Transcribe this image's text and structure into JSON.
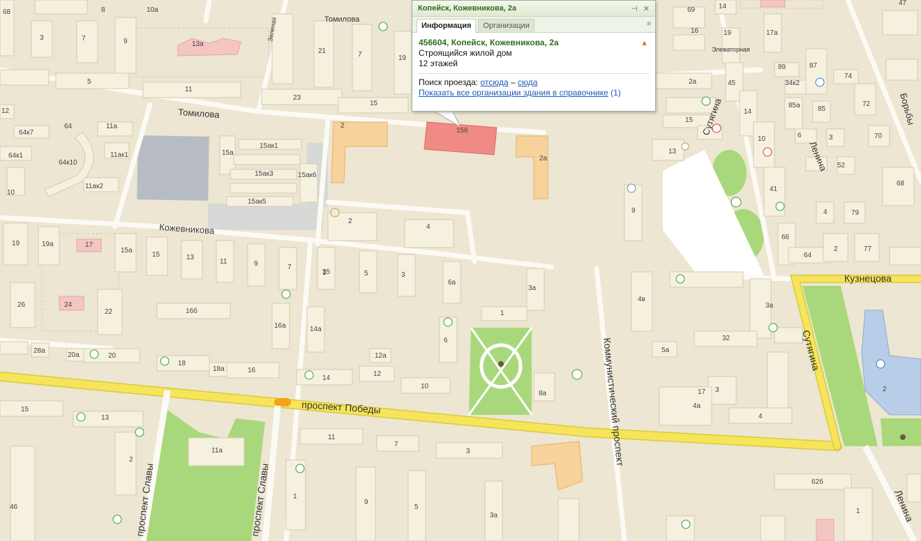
{
  "popup": {
    "header": "Копейск, Кожевникова, 2а",
    "pin_icon": "pin-icon",
    "close_icon": "close-icon",
    "tabs": [
      "Информация",
      "Организации"
    ],
    "title": "456604, Копейск, Кожевникова, 2а",
    "subtitle": "Строящийся жилой дом",
    "floors": "12 этажей",
    "route_label": "Поиск проезда:",
    "route_from": "отсюда",
    "route_dash": "–",
    "route_to": "сюда",
    "orgs_link": "Показать все организации здания в справочнике",
    "orgs_count": "(1)"
  },
  "map": {
    "colors": {
      "ground": "#ece6d2",
      "building": "#f6f1df",
      "road": "#fbfaf5",
      "main_road": "#f6e55a",
      "park": "#a9d87c",
      "highlight": "#ef8a85",
      "construction": "#f8d29b",
      "gray_block": "#b7bcc4",
      "blue": "#b8cde8"
    },
    "streets": [
      {
        "id": "tomilova-1",
        "text": "Томилова"
      },
      {
        "id": "tomilova-2",
        "text": "Томилова"
      },
      {
        "id": "kozhevnikova",
        "text": "Кожевникова"
      },
      {
        "id": "pobedy",
        "text": "проспект Победы"
      },
      {
        "id": "slavy-1",
        "text": "проспект Славы"
      },
      {
        "id": "slavy-2",
        "text": "проспект Славы"
      },
      {
        "id": "kommunist",
        "text": "Коммунистический проспект"
      },
      {
        "id": "sutyagina-1",
        "text": "Сутягина"
      },
      {
        "id": "sutyagina-2",
        "text": "Сутягина"
      },
      {
        "id": "lenina-1",
        "text": "Ленина"
      },
      {
        "id": "lenina-2",
        "text": "Ленина"
      },
      {
        "id": "kuznetsova",
        "text": "Кузнецова"
      },
      {
        "id": "borby",
        "text": "Борьбы"
      },
      {
        "id": "zelenaya",
        "text": "Зеленая"
      },
      {
        "id": "elevatornaya",
        "text": "Элеваторная"
      }
    ],
    "numbers": [
      "68",
      "8",
      "10a",
      "3",
      "7",
      "9",
      "13a",
      "5",
      "11",
      "12",
      "64к7",
      "64",
      "11a",
      "64к1",
      "15a",
      "15aк1",
      "64к10",
      "11aк1",
      "15aк3",
      "15aк6",
      "10",
      "11aк2",
      "15aк5",
      "19",
      "19a",
      "17",
      "15a",
      "15",
      "13",
      "11",
      "9",
      "7",
      "26",
      "24",
      "22",
      "16б",
      "16a",
      "14a",
      "28a",
      "20a",
      "20",
      "18",
      "18a",
      "16",
      "14",
      "12",
      "12a",
      "10",
      "15",
      "13",
      "11a",
      "2",
      "46",
      "1",
      "9",
      "5",
      "3a",
      "11",
      "7",
      "3",
      "1",
      "2",
      "4",
      "2",
      "156",
      "2a",
      "35",
      "5",
      "3",
      "3a",
      "6a",
      "1",
      "6",
      "8a",
      "4в",
      "5a",
      "32",
      "3a",
      "3",
      "4a",
      "4",
      "2",
      "62б",
      "1",
      "69",
      "19",
      "14",
      "16",
      "17a",
      "89",
      "87",
      "74",
      "47",
      "34к2",
      "85a",
      "85",
      "72",
      "45",
      "14",
      "10",
      "6",
      "3",
      "70",
      "52",
      "68",
      "41",
      "4",
      "79",
      "66",
      "2",
      "77",
      "64",
      "2a",
      "15",
      "13",
      "9",
      "7",
      "21",
      "19",
      "23",
      "15",
      "17",
      "2"
    ]
  }
}
